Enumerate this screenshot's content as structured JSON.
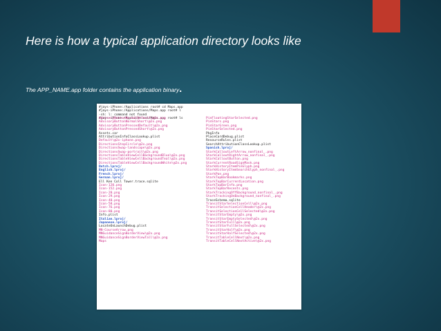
{
  "slide": {
    "title": "Here is how a typical application directory looks like",
    "bullet": "The APP_NAME.app folder contains the application binary",
    "bullet_end": "."
  },
  "colors": {
    "accent": "#c0392b",
    "file_pink": "#cc2b86",
    "dir_blue": "#2a56c6",
    "plain": "#1a1a1a"
  },
  "terminal": {
    "commands": [
      "#jays-iPhone:/Applications root# cd Maps.app",
      "#jays-iPhone:/Applications/Maps.app root# l",
      "-sh: l: command not found",
      "#jays-iPhone:/Applications/Maps.app root# ls"
    ],
    "left_column": [
      {
        "text": "AdvisoryButtonNormalDefault\\@2x.png",
        "kind": "pink"
      },
      {
        "text": "AdvisoryButtonNormalShort\\@2x.png",
        "kind": "pink"
      },
      {
        "text": "AdvisoryButtonPressedDefault\\@2x.png",
        "kind": "pink"
      },
      {
        "text": "AdvisoryButtonPressedShort\\@2x.png",
        "kind": "pink"
      },
      {
        "text": "Assets.car",
        "kind": "black"
      },
      {
        "text": "AttributionInfoClassLookup.plist",
        "kind": "black"
      },
      {
        "text": "Default\\@2x-iphone.png",
        "kind": "pink"
      },
      {
        "text": "DirectionsStepCircle\\@2x.png",
        "kind": "pink"
      },
      {
        "text": "DirectionsSwap-landscape\\@2x.png",
        "kind": "pink"
      },
      {
        "text": "DirectionsSwap-portrait\\@2x.png",
        "kind": "pink"
      },
      {
        "text": "DirectionsTableViewCellBackgroundBlue\\@2x.png",
        "kind": "pink"
      },
      {
        "text": "DirectionsTableViewCellBackgroundTeal\\@2x.png",
        "kind": "pink"
      },
      {
        "text": "DirectionsTableViewCellBackgroundWhite\\@2x.png",
        "kind": "pink"
      },
      {
        "text": "Dutch.lproj/",
        "kind": "blue"
      },
      {
        "text": "English.lproj/",
        "kind": "blue"
      },
      {
        "text": "French.lproj/",
        "kind": "blue"
      },
      {
        "text": "German.lproj/",
        "kind": "blue"
      },
      {
        "text": "Ell Ken Coll Tower.trace.sqlite",
        "kind": "black"
      },
      {
        "text": "Icon-120.png",
        "kind": "pink"
      },
      {
        "text": "Icon-152.png",
        "kind": "pink"
      },
      {
        "text": "Icon-20.png",
        "kind": "pink"
      },
      {
        "text": "Icon-29.png",
        "kind": "pink"
      },
      {
        "text": "Icon-40.png",
        "kind": "pink"
      },
      {
        "text": "Icon-58.png",
        "kind": "pink"
      },
      {
        "text": "Icon-76.png",
        "kind": "pink"
      },
      {
        "text": "Icon-80.png",
        "kind": "pink"
      },
      {
        "text": "Info.plist",
        "kind": "black"
      },
      {
        "text": "Italian.lproj/",
        "kind": "blue"
      },
      {
        "text": "Japanese.lproj/",
        "kind": "blue"
      },
      {
        "text": "LocateOnLaunchDebug.plist",
        "kind": "black"
      },
      {
        "text": "MN-CourseArrow.png",
        "kind": "pink"
      },
      {
        "text": "MNGuidanceSignBorderView\\@2x.png",
        "kind": "pink"
      },
      {
        "text": "MNGuidanceSignBorderViewTall\\@2x.png",
        "kind": "pink"
      },
      {
        "text": "Maps",
        "kind": "pink"
      }
    ],
    "right_column": [
      {
        "text": "PinFloatingStarSelected.png",
        "kind": "pink"
      },
      {
        "text": "PinStars.png",
        "kind": "pink"
      },
      {
        "text": "PinStarGreen.png",
        "kind": "pink"
      },
      {
        "text": "PinStarSelected.png",
        "kind": "pink"
      },
      {
        "text": "PkgInfo",
        "kind": "black"
      },
      {
        "text": "PlaceCardDebug.plist",
        "kind": "black"
      },
      {
        "text": "ResourceRules.plist",
        "kind": "black"
      },
      {
        "text": "SearchAttributionClassLookup.plist",
        "kind": "black"
      },
      {
        "text": "Spanish.lproj/",
        "kind": "blue"
      },
      {
        "text": "StarkCalloutLeftArrow_nonfinal_.png",
        "kind": "pink"
      },
      {
        "text": "StarkCalloutRightArrow_nonfinal_.png",
        "kind": "pink"
      },
      {
        "text": "StarkCalloutButton.png",
        "kind": "pink"
      },
      {
        "text": "StarkCurrentRoadSignMask.png",
        "kind": "pink"
      },
      {
        "text": "StarkHistoryItemPinGlyph.png",
        "kind": "pink"
      },
      {
        "text": "StarkHistoryItemSearchGlyph_nonfinal_.png",
        "kind": "pink"
      },
      {
        "text": "StarkPan.png",
        "kind": "pink"
      },
      {
        "text": "StarkTopBarBookmarks.png",
        "kind": "pink"
      },
      {
        "text": "StarkTopBarCurrentLocation.png",
        "kind": "pink"
      },
      {
        "text": "StarkTopBarInfo.png",
        "kind": "pink"
      },
      {
        "text": "StarkTopBarRecents.png",
        "kind": "pink"
      },
      {
        "text": "StarkTrackingOffBackground_nonfinal_.png",
        "kind": "pink"
      },
      {
        "text": "StarkTrackingOnBackground_nonfinal_.png",
        "kind": "pink"
      },
      {
        "text": "TraceSchema.sqlite",
        "kind": "black"
      },
      {
        "text": "TransitStarSelectionCell\\@2x.png",
        "kind": "pink"
      },
      {
        "text": "TransitSelectionCellHeader\\@2x.png",
        "kind": "pink"
      },
      {
        "text": "TransitSelectionCellSelected\\@2x.png",
        "kind": "pink"
      },
      {
        "text": "TransitStarEmpty\\@2x.png",
        "kind": "pink"
      },
      {
        "text": "TransitStarEmptySelected\\@2x.png",
        "kind": "pink"
      },
      {
        "text": "TransitStarFull\\@2x.png",
        "kind": "pink"
      },
      {
        "text": "TransitStarFullSelected\\@2x.png",
        "kind": "pink"
      },
      {
        "text": "TransitStarHalf\\@2x.png",
        "kind": "pink"
      },
      {
        "text": "TransitStarHalfSelected\\@2x.png",
        "kind": "pink"
      },
      {
        "text": "TransitTableCellNext\\@2x.png",
        "kind": "pink"
      },
      {
        "text": "TransitTableCellNextActive\\@2x.png",
        "kind": "pink"
      }
    ]
  }
}
